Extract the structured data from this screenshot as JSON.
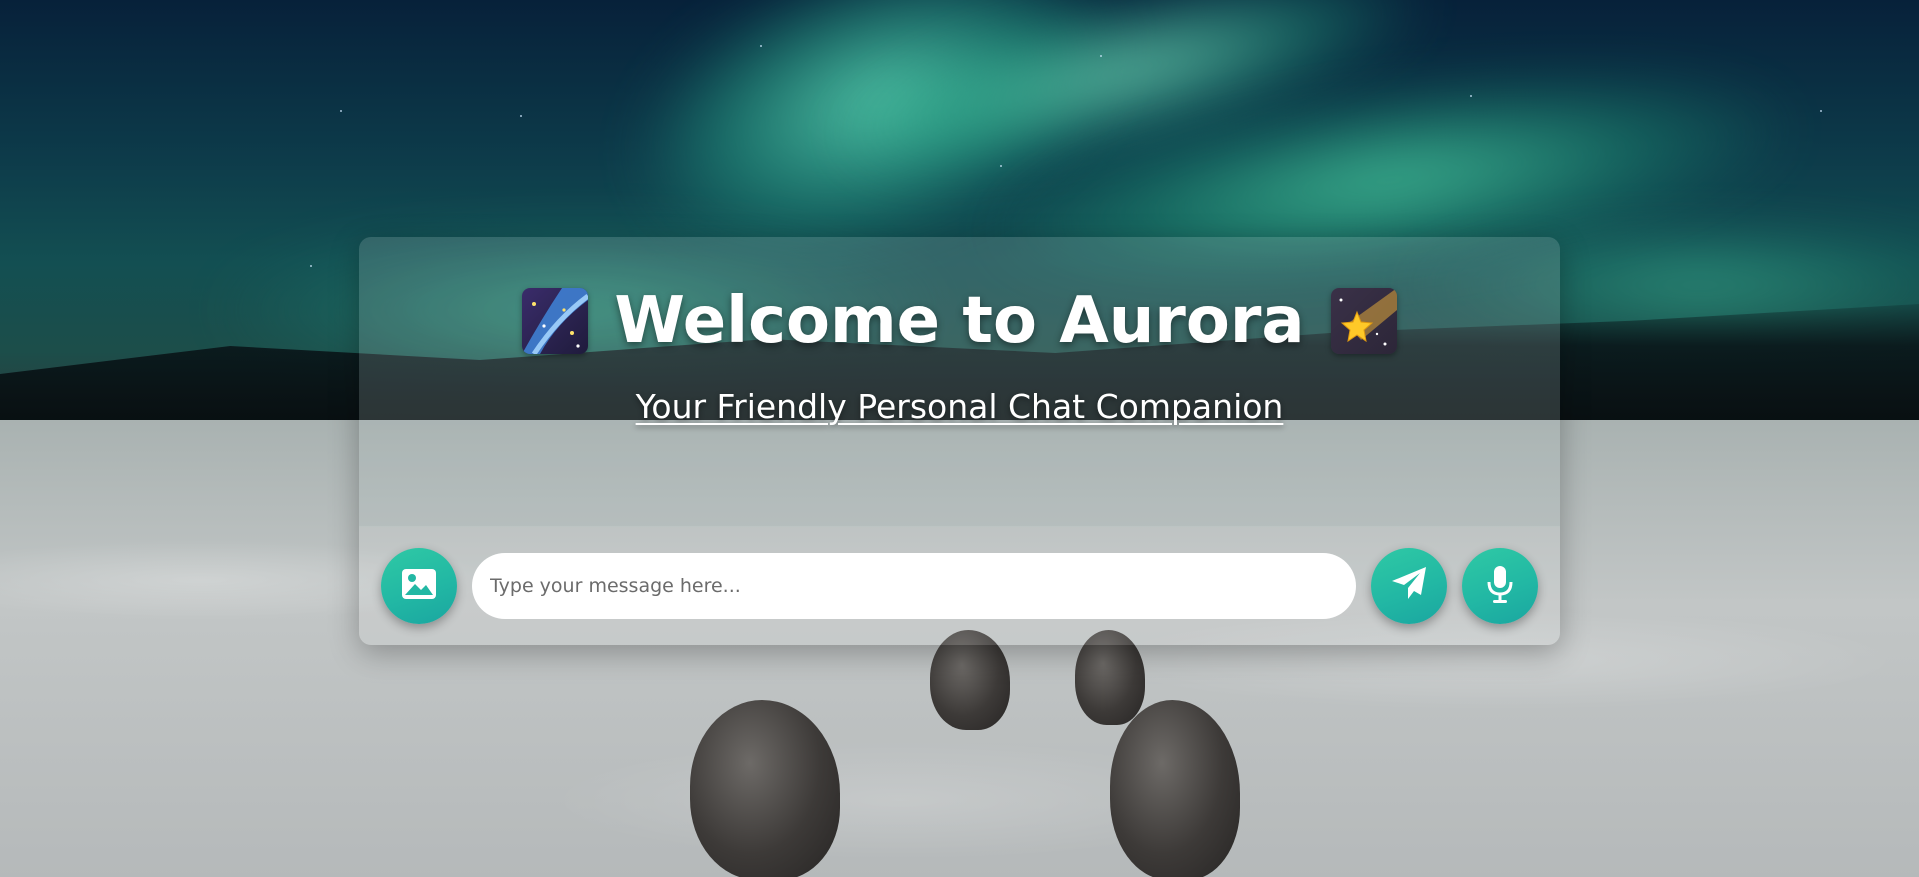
{
  "header": {
    "title": "Welcome to Aurora",
    "subtitle": "Your Friendly Personal Chat Companion",
    "left_emoji": "milky-way-icon",
    "right_emoji": "shooting-star-icon"
  },
  "composer": {
    "placeholder": "Type your message here...",
    "value": "",
    "image_button_icon": "image-icon",
    "send_button_icon": "paper-plane-icon",
    "mic_button_icon": "microphone-icon"
  },
  "colors": {
    "accent": "#22b8a4",
    "accent_light": "#2fc9a5",
    "title_text": "#ffffff",
    "input_bg": "#ffffff"
  }
}
